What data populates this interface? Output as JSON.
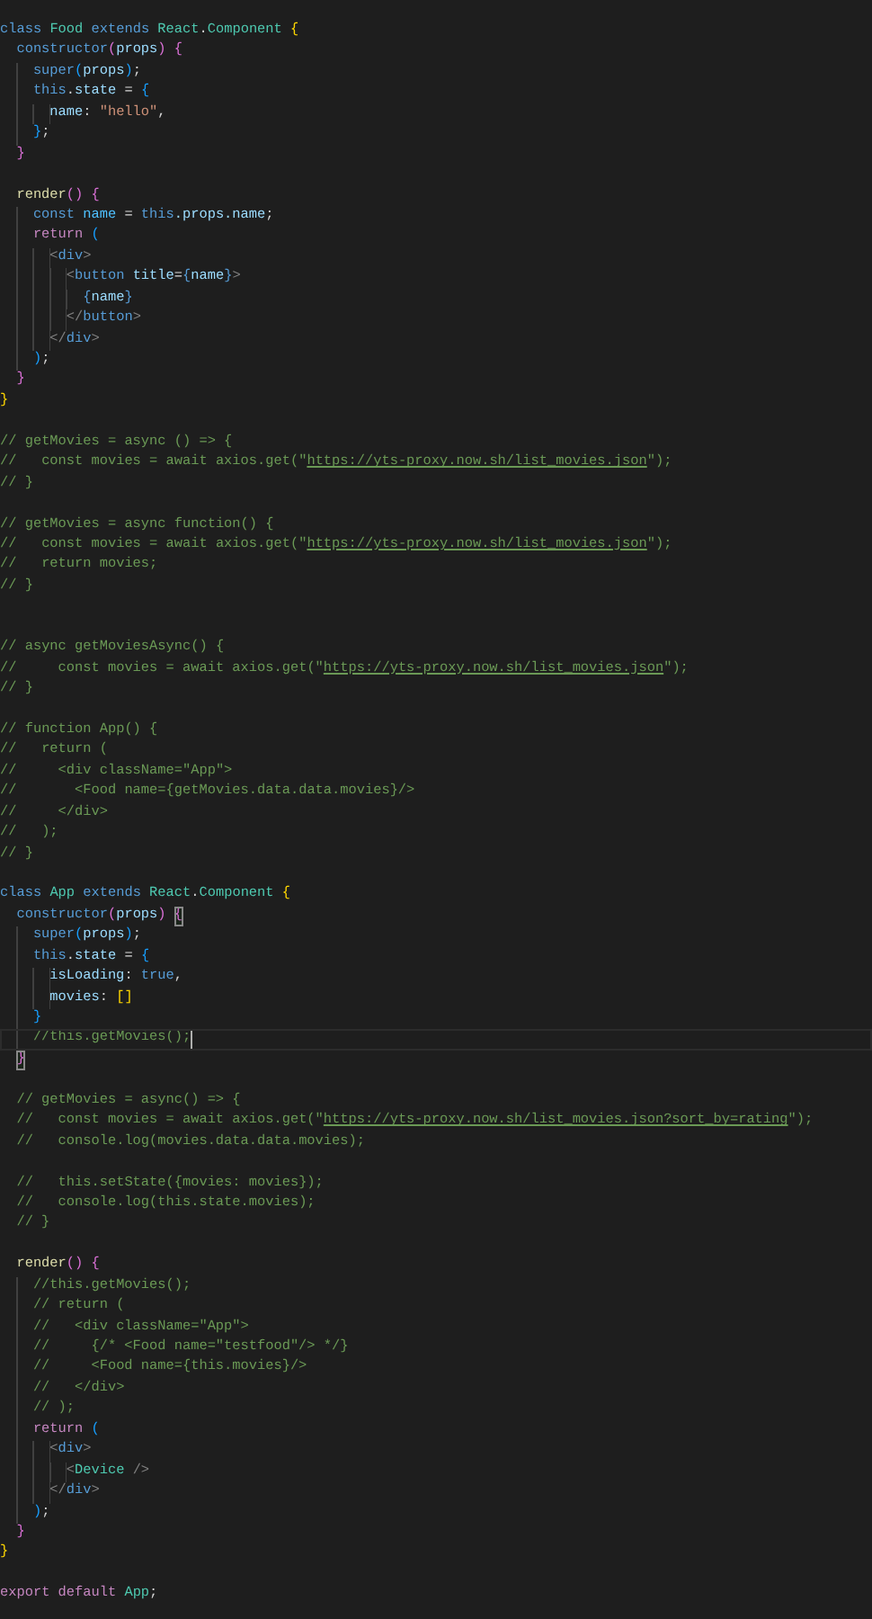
{
  "editor": {
    "blocks": [
      {
        "lines": [
          {
            "tokens": [
              {
                "text": "class ",
                "kind": "kw"
              },
              {
                "text": "Food ",
                "kind": "cls"
              },
              {
                "text": "extends ",
                "kind": "kw"
              },
              {
                "text": "React",
                "kind": "cls"
              },
              {
                "text": ".",
                "kind": "pun"
              },
              {
                "text": "Component ",
                "kind": "cls"
              },
              {
                "text": "{",
                "kind": "b1"
              }
            ]
          },
          {
            "tokens": [
              {
                "text": "  constructor",
                "kind": "kw"
              },
              {
                "text": "(",
                "kind": "b2"
              },
              {
                "text": "props",
                "kind": "var"
              },
              {
                "text": ") ",
                "kind": "b2"
              },
              {
                "text": "{",
                "kind": "b2"
              }
            ]
          },
          {
            "tokens": [
              {
                "text": "    super",
                "kind": "kw"
              },
              {
                "text": "(",
                "kind": "b3"
              },
              {
                "text": "props",
                "kind": "var"
              },
              {
                "text": ")",
                "kind": "b3"
              },
              {
                "text": ";",
                "kind": "pun"
              }
            ]
          },
          {
            "tokens": [
              {
                "text": "    this",
                "kind": "kw"
              },
              {
                "text": ".",
                "kind": "pun"
              },
              {
                "text": "state",
                "kind": "var"
              },
              {
                "text": " = ",
                "kind": "pun"
              },
              {
                "text": "{",
                "kind": "b3"
              }
            ]
          },
          {
            "tokens": [
              {
                "text": "      name",
                "kind": "var"
              },
              {
                "text": ": ",
                "kind": "pun"
              },
              {
                "text": "\"hello\"",
                "kind": "str"
              },
              {
                "text": ",",
                "kind": "pun"
              }
            ]
          },
          {
            "tokens": [
              {
                "text": "    }",
                "kind": "b3"
              },
              {
                "text": ";",
                "kind": "pun"
              }
            ]
          },
          {
            "tokens": [
              {
                "text": "  }",
                "kind": "b2"
              }
            ]
          }
        ]
      },
      {
        "lines": [
          {
            "tokens": [
              {
                "text": "  render",
                "kind": "fn"
              },
              {
                "text": "() ",
                "kind": "b2"
              },
              {
                "text": "{",
                "kind": "b2"
              }
            ]
          },
          {
            "tokens": [
              {
                "text": "    const ",
                "kind": "kw"
              },
              {
                "text": "name",
                "kind": "const"
              },
              {
                "text": " = ",
                "kind": "pun"
              },
              {
                "text": "this",
                "kind": "kw"
              },
              {
                "text": ".props.name",
                "kind": "var"
              },
              {
                "text": ";",
                "kind": "pun"
              }
            ]
          },
          {
            "tokens": [
              {
                "text": "    return ",
                "kind": "ctl"
              },
              {
                "text": "(",
                "kind": "b3"
              }
            ]
          },
          {
            "tokens": [
              {
                "text": "      <",
                "kind": "tagp"
              },
              {
                "text": "div",
                "kind": "tag"
              },
              {
                "text": ">",
                "kind": "tagp"
              }
            ]
          },
          {
            "tokens": [
              {
                "text": "        <",
                "kind": "tagp"
              },
              {
                "text": "button",
                "kind": "tag"
              },
              {
                "text": " title",
                "kind": "var"
              },
              {
                "text": "=",
                "kind": "pun"
              },
              {
                "text": "{",
                "kind": "tag"
              },
              {
                "text": "name",
                "kind": "var"
              },
              {
                "text": "}",
                "kind": "tag"
              },
              {
                "text": ">",
                "kind": "tagp"
              }
            ]
          },
          {
            "tokens": [
              {
                "text": "          {",
                "kind": "tag"
              },
              {
                "text": "name",
                "kind": "var"
              },
              {
                "text": "}",
                "kind": "tag"
              }
            ]
          },
          {
            "tokens": [
              {
                "text": "        </",
                "kind": "tagp"
              },
              {
                "text": "button",
                "kind": "tag"
              },
              {
                "text": ">",
                "kind": "tagp"
              }
            ]
          },
          {
            "tokens": [
              {
                "text": "      </",
                "kind": "tagp"
              },
              {
                "text": "div",
                "kind": "tag"
              },
              {
                "text": ">",
                "kind": "tagp"
              }
            ]
          },
          {
            "tokens": [
              {
                "text": "    )",
                "kind": "b3"
              },
              {
                "text": ";",
                "kind": "pun"
              }
            ]
          },
          {
            "tokens": [
              {
                "text": "  }",
                "kind": "b2"
              }
            ]
          },
          {
            "tokens": [
              {
                "text": "}",
                "kind": "b1"
              }
            ]
          }
        ]
      },
      {
        "lines": [
          {
            "tokens": [
              {
                "text": "// getMovies = async () => {",
                "kind": "cmt"
              }
            ]
          },
          {
            "tokens": [
              {
                "text": "//   const movies = await axios.get(\"",
                "kind": "cmt"
              },
              {
                "text": "https://yts-proxy.now.sh/list_movies.json",
                "kind": "link"
              },
              {
                "text": "\");",
                "kind": "cmt"
              }
            ]
          },
          {
            "tokens": [
              {
                "text": "// }",
                "kind": "cmt"
              }
            ]
          }
        ]
      },
      {
        "lines": [
          {
            "tokens": [
              {
                "text": "// getMovies = async function() {",
                "kind": "cmt"
              }
            ]
          },
          {
            "tokens": [
              {
                "text": "//   const movies = await axios.get(\"",
                "kind": "cmt"
              },
              {
                "text": "https://yts-proxy.now.sh/list_movies.json",
                "kind": "link"
              },
              {
                "text": "\");",
                "kind": "cmt"
              }
            ]
          },
          {
            "tokens": [
              {
                "text": "//   return movies;",
                "kind": "cmt"
              }
            ]
          },
          {
            "tokens": [
              {
                "text": "// }",
                "kind": "cmt"
              }
            ]
          }
        ]
      },
      {
        "extra_gap": true,
        "lines": [
          {
            "tokens": [
              {
                "text": "// async getMoviesAsync() {",
                "kind": "cmt"
              }
            ]
          },
          {
            "tokens": [
              {
                "text": "//     const movies = await axios.get(\"",
                "kind": "cmt"
              },
              {
                "text": "https://yts-proxy.now.sh/list_movies.json",
                "kind": "link"
              },
              {
                "text": "\");",
                "kind": "cmt"
              }
            ]
          },
          {
            "tokens": [
              {
                "text": "// }",
                "kind": "cmt"
              }
            ]
          }
        ]
      },
      {
        "lines": [
          {
            "tokens": [
              {
                "text": "// function App() {",
                "kind": "cmt"
              }
            ]
          },
          {
            "tokens": [
              {
                "text": "//   return (",
                "kind": "cmt"
              }
            ]
          },
          {
            "tokens": [
              {
                "text": "//     <div className=\"App\">",
                "kind": "cmt"
              }
            ]
          },
          {
            "tokens": [
              {
                "text": "//       <Food name={getMovies.data.data.movies}/>",
                "kind": "cmt"
              }
            ]
          },
          {
            "tokens": [
              {
                "text": "//     </div>",
                "kind": "cmt"
              }
            ]
          },
          {
            "tokens": [
              {
                "text": "//   );",
                "kind": "cmt"
              }
            ]
          },
          {
            "tokens": [
              {
                "text": "// }",
                "kind": "cmt"
              }
            ]
          }
        ]
      },
      {
        "lines": [
          {
            "tokens": [
              {
                "text": "class ",
                "kind": "kw"
              },
              {
                "text": "App ",
                "kind": "cls"
              },
              {
                "text": "extends ",
                "kind": "kw"
              },
              {
                "text": "React",
                "kind": "cls"
              },
              {
                "text": ".",
                "kind": "pun"
              },
              {
                "text": "Component ",
                "kind": "cls"
              },
              {
                "text": "{",
                "kind": "b1"
              }
            ]
          },
          {
            "tokens": [
              {
                "text": "  constructor",
                "kind": "kw"
              },
              {
                "text": "(",
                "kind": "b2"
              },
              {
                "text": "props",
                "kind": "var"
              },
              {
                "text": ") ",
                "kind": "b2"
              },
              {
                "text": "{",
                "kind": "b2",
                "matched": true
              }
            ]
          },
          {
            "tokens": [
              {
                "text": "    super",
                "kind": "kw"
              },
              {
                "text": "(",
                "kind": "b3"
              },
              {
                "text": "props",
                "kind": "var"
              },
              {
                "text": ")",
                "kind": "b3"
              },
              {
                "text": ";",
                "kind": "pun"
              }
            ]
          },
          {
            "tokens": [
              {
                "text": "    this",
                "kind": "kw"
              },
              {
                "text": ".",
                "kind": "pun"
              },
              {
                "text": "state",
                "kind": "var"
              },
              {
                "text": " = ",
                "kind": "pun"
              },
              {
                "text": "{",
                "kind": "b3"
              }
            ]
          },
          {
            "tokens": [
              {
                "text": "      isLoading",
                "kind": "var"
              },
              {
                "text": ": ",
                "kind": "pun"
              },
              {
                "text": "true",
                "kind": "kw"
              },
              {
                "text": ",",
                "kind": "pun"
              }
            ]
          },
          {
            "tokens": [
              {
                "text": "      movies",
                "kind": "var"
              },
              {
                "text": ": ",
                "kind": "pun"
              },
              {
                "text": "[]",
                "kind": "b1"
              }
            ]
          },
          {
            "tokens": [
              {
                "text": "    }",
                "kind": "b3"
              }
            ]
          },
          {
            "current": true,
            "tokens": [
              {
                "text": "    //this.getMovies();",
                "kind": "cmt"
              }
            ]
          },
          {
            "tokens": [
              {
                "text": "  }",
                "kind": "b2",
                "matched": true
              }
            ]
          }
        ]
      },
      {
        "lines": [
          {
            "tokens": [
              {
                "text": "  // getMovies = async() => {",
                "kind": "cmt"
              }
            ]
          },
          {
            "tokens": [
              {
                "text": "  //   const movies = await axios.get(\"",
                "kind": "cmt"
              },
              {
                "text": "https://yts-proxy.now.sh/list_movies.json?sort_by=rating",
                "kind": "link"
              },
              {
                "text": "\");",
                "kind": "cmt"
              }
            ]
          },
          {
            "tokens": [
              {
                "text": "  //   console.log(movies.data.data.movies);",
                "kind": "cmt"
              }
            ]
          }
        ]
      },
      {
        "lines": [
          {
            "tokens": [
              {
                "text": "  //   this.setState({movies: movies});",
                "kind": "cmt"
              }
            ]
          },
          {
            "tokens": [
              {
                "text": "  //   console.log(this.state.movies);",
                "kind": "cmt"
              }
            ]
          },
          {
            "tokens": [
              {
                "text": "  // }",
                "kind": "cmt"
              }
            ]
          }
        ]
      },
      {
        "lines": [
          {
            "tokens": [
              {
                "text": "  render",
                "kind": "fn"
              },
              {
                "text": "() ",
                "kind": "b2"
              },
              {
                "text": "{",
                "kind": "b2"
              }
            ]
          },
          {
            "tokens": [
              {
                "text": "    //this.getMovies();",
                "kind": "cmt"
              }
            ]
          },
          {
            "tokens": [
              {
                "text": "    // return (",
                "kind": "cmt"
              }
            ]
          },
          {
            "tokens": [
              {
                "text": "    //   <div className=\"App\">",
                "kind": "cmt"
              }
            ]
          },
          {
            "tokens": [
              {
                "text": "    //     {/* <Food name=\"testfood\"/> */}",
                "kind": "cmt"
              }
            ]
          },
          {
            "tokens": [
              {
                "text": "    //     <Food name={this.movies}/>",
                "kind": "cmt"
              }
            ]
          },
          {
            "tokens": [
              {
                "text": "    //   </div>",
                "kind": "cmt"
              }
            ]
          },
          {
            "tokens": [
              {
                "text": "    // );",
                "kind": "cmt"
              }
            ]
          },
          {
            "tokens": [
              {
                "text": "    return ",
                "kind": "ctl"
              },
              {
                "text": "(",
                "kind": "b3"
              }
            ]
          },
          {
            "tokens": [
              {
                "text": "      <",
                "kind": "tagp"
              },
              {
                "text": "div",
                "kind": "tag"
              },
              {
                "text": ">",
                "kind": "tagp"
              }
            ]
          },
          {
            "tokens": [
              {
                "text": "        <",
                "kind": "tagp"
              },
              {
                "text": "Device",
                "kind": "cls"
              },
              {
                "text": " />",
                "kind": "tagp"
              }
            ]
          },
          {
            "tokens": [
              {
                "text": "      </",
                "kind": "tagp"
              },
              {
                "text": "div",
                "kind": "tag"
              },
              {
                "text": ">",
                "kind": "tagp"
              }
            ]
          },
          {
            "tokens": [
              {
                "text": "    )",
                "kind": "b3"
              },
              {
                "text": ";",
                "kind": "pun"
              }
            ]
          },
          {
            "tokens": [
              {
                "text": "  }",
                "kind": "b2"
              }
            ]
          },
          {
            "tokens": [
              {
                "text": "}",
                "kind": "b1"
              }
            ]
          }
        ]
      },
      {
        "lines": [
          {
            "tokens": [
              {
                "text": "export ",
                "kind": "ctl"
              },
              {
                "text": "default ",
                "kind": "ctl"
              },
              {
                "text": "App",
                "kind": "cls"
              },
              {
                "text": ";",
                "kind": "pun"
              }
            ]
          }
        ]
      }
    ]
  }
}
